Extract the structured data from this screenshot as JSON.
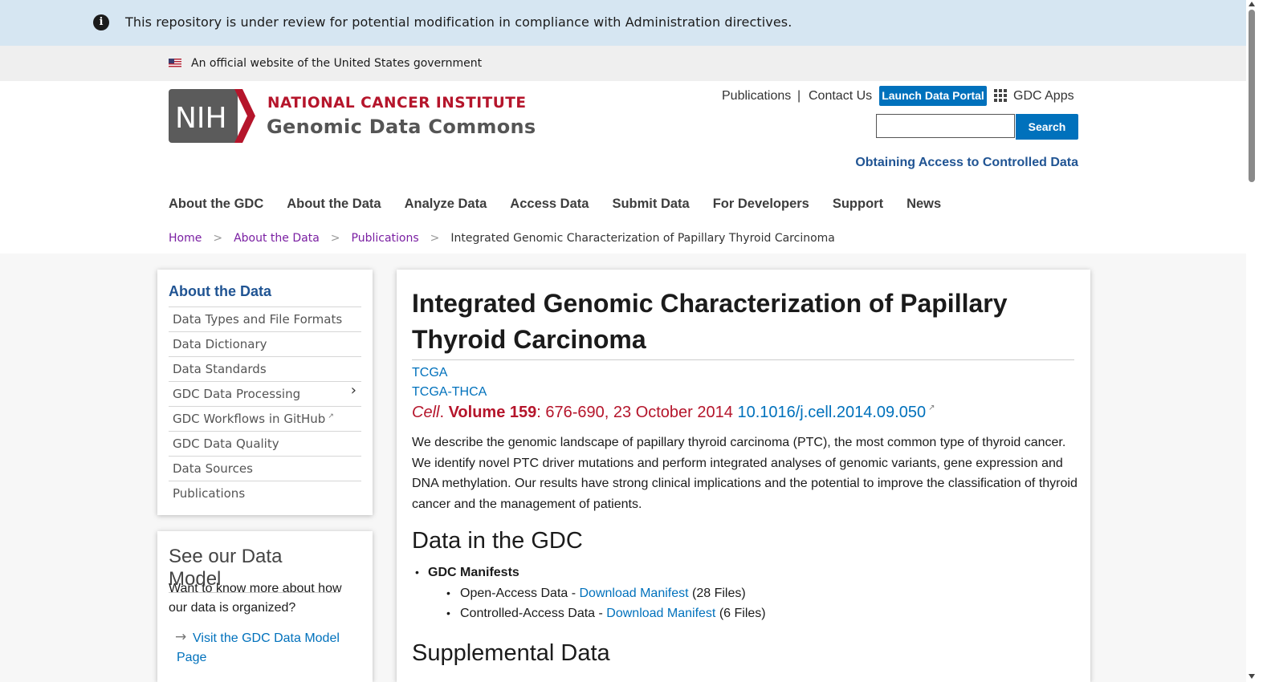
{
  "review_banner": {
    "message": "This repository is under review for potential modification in compliance with Administration directives."
  },
  "gov_banner": {
    "text": "An official website of the United States government"
  },
  "logo": {
    "nih": "NIH",
    "institute": "NATIONAL CANCER INSTITUTE",
    "site": "Genomic Data Commons"
  },
  "utility": {
    "publications": "Publications",
    "separator": "|",
    "contact": "Contact Us",
    "launch": "Launch Data Portal",
    "apps": "GDC Apps"
  },
  "search": {
    "value": "",
    "button": "Search"
  },
  "controlled_link": "Obtaining Access to Controlled Data",
  "nav": [
    "About the GDC",
    "About the Data",
    "Analyze Data",
    "Access Data",
    "Submit Data",
    "For Developers",
    "Support",
    "News"
  ],
  "breadcrumb": {
    "home": "Home",
    "sep": ">",
    "about": "About the Data",
    "pubs": "Publications",
    "current": "Integrated Genomic Characterization of Papillary Thyroid Carcinoma"
  },
  "sidebar": {
    "title": "About the Data",
    "items": [
      "Data Types and File Formats",
      "Data Dictionary",
      "Data Standards",
      "GDC Data Processing",
      "GDC Workflows in GitHub",
      "GDC Data Quality",
      "Data Sources",
      "Publications"
    ]
  },
  "model_card": {
    "title": "See our Data Model",
    "text": "Want to know more about how our data is organized?",
    "arrow": "→",
    "link": "Visit the GDC Data Model Page"
  },
  "article": {
    "title": "Integrated Genomic Characterization of Papillary Thyroid Carcinoma",
    "program": "TCGA",
    "project": "TCGA-THCA",
    "journal": "Cell",
    "journal_dot": ".",
    "volume": "Volume 159",
    "pages_date": ": 676-690, 23 October 2014",
    "doi": "10.1016/j.cell.2014.09.050",
    "abstract": "We describe the genomic landscape of papillary thyroid carcinoma (PTC), the most common type of thyroid cancer. We identify novel PTC driver mutations and perform integrated analyses of genomic variants, gene expression and DNA methylation. Our results have strong clinical implications and the potential to improve the classification of thyroid cancer and the management of patients.",
    "section_gdc": "Data in the GDC",
    "manifests_label": "GDC Manifests",
    "open_label": "Open-Access Data - ",
    "open_link": "Download Manifest",
    "open_count": " (28 Files)",
    "controlled_label": "Controlled-Access Data - ",
    "controlled_link": "Download Manifest",
    "controlled_count": " (6 Files)",
    "section_supp": "Supplemental Data"
  },
  "colors": {
    "banner_bg": "#d6e6f2",
    "nih_red": "#b5152b",
    "link_blue": "#0071bc",
    "button_blue": "#0071bc"
  }
}
